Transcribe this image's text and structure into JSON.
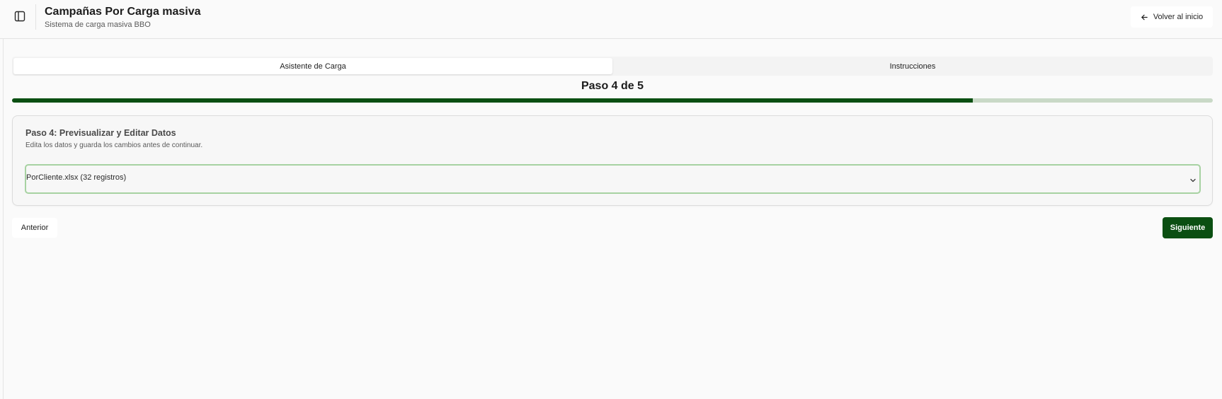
{
  "header": {
    "title": "Campañas Por Carga masiva",
    "subtitle": "Sistema de carga masiva BBO",
    "back_label": "Volver al inicio",
    "toggle_icon": "sidebar-panel-icon",
    "back_icon": "arrow-left-icon"
  },
  "tabs": [
    {
      "label": "Asistente de Carga",
      "active": true
    },
    {
      "label": "Instrucciones",
      "active": false
    }
  ],
  "step": {
    "label": "Paso 4 de 5",
    "current": 4,
    "total": 5,
    "progress_percent": 80
  },
  "card": {
    "title": "Paso 4: Previsualizar y Editar Datos",
    "description": "Edita los datos y guarda los cambios antes de continuar.",
    "file_select": {
      "value": "PorCliente.xlsx (32 registros)",
      "icon": "chevron-down-icon"
    }
  },
  "footer": {
    "prev_label": "Anterior",
    "next_label": "Siguiente"
  },
  "colors": {
    "accent": "#0b4f12",
    "progress_track": "#c9d9c7",
    "select_border": "#a7d2a2",
    "background": "#fafafa"
  }
}
